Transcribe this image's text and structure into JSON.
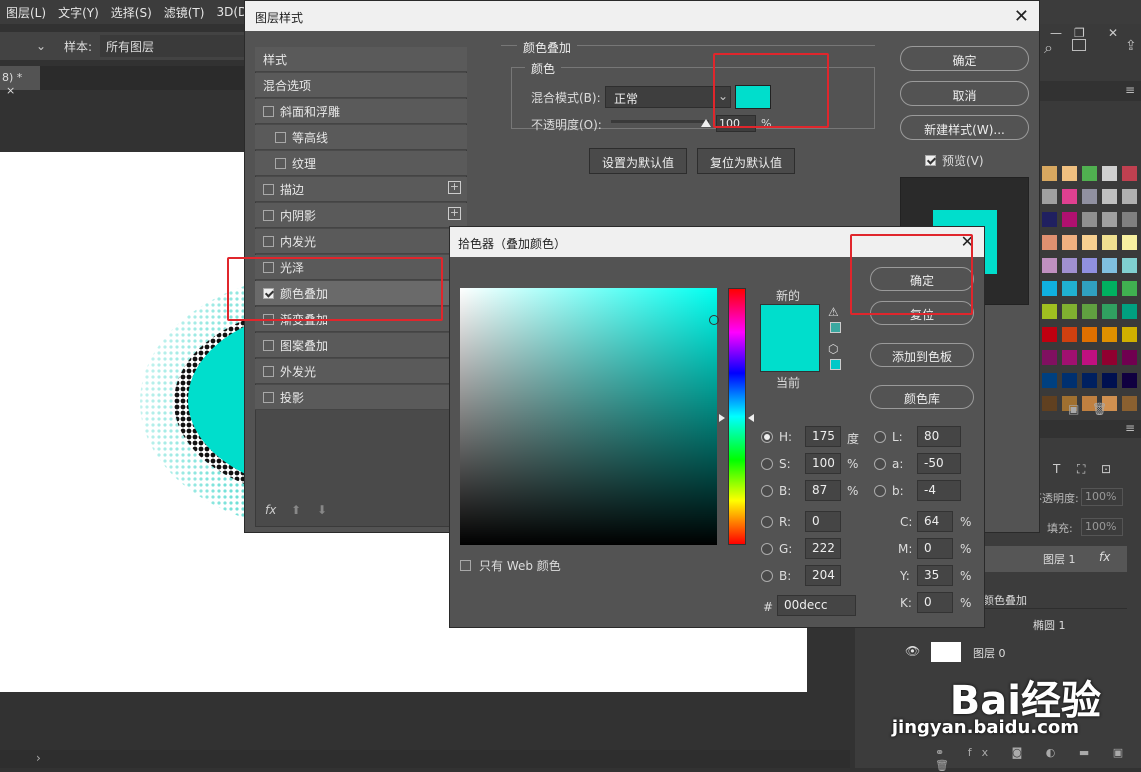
{
  "menubar": {
    "items": [
      "图层(L)",
      "文字(Y)",
      "选择(S)",
      "滤镜(T)",
      "3D(D)"
    ]
  },
  "options_bar": {
    "sample_label": "样本:",
    "sample_value": "所有图层"
  },
  "doc_tab": {
    "label": "8) *",
    "close": "×"
  },
  "layer_style_dialog": {
    "title": "图层样式",
    "close": "✕",
    "left_list": {
      "styles_header": "样式",
      "blend_options": "混合选项",
      "items": [
        {
          "label": "斜面和浮雕",
          "checked": false
        },
        {
          "label": "等高线",
          "checked": false
        },
        {
          "label": "纹理",
          "checked": false
        },
        {
          "label": "描边",
          "checked": false
        },
        {
          "label": "内阴影",
          "checked": false
        },
        {
          "label": "内发光",
          "checked": false
        },
        {
          "label": "光泽",
          "checked": false
        },
        {
          "label": "颜色叠加",
          "checked": true
        },
        {
          "label": "渐变叠加",
          "checked": false
        },
        {
          "label": "图案叠加",
          "checked": false
        },
        {
          "label": "外发光",
          "checked": false
        },
        {
          "label": "投影",
          "checked": false
        }
      ],
      "fx_label": "fx"
    },
    "color_overlay": {
      "section_title": "颜色叠加",
      "group_title": "颜色",
      "blend_mode_label": "混合模式(B):",
      "blend_mode_value": "正常",
      "opacity_label": "不透明度(O):",
      "opacity_value": "100",
      "opacity_unit": "%",
      "overlay_color": "#00decc",
      "make_default": "设置为默认值",
      "reset_default": "复位为默认值"
    },
    "buttons": {
      "ok": "确定",
      "cancel": "取消",
      "new_style": "新建样式(W)...",
      "preview": "预览(V)"
    }
  },
  "color_picker": {
    "title": "拾色器（叠加颜色）",
    "close": "✕",
    "new_label": "新的",
    "current_label": "当前",
    "new_color": "#00decc",
    "current_color": "#00decc",
    "buttons": {
      "ok": "确定",
      "reset": "复位",
      "add_swatch": "添加到色板",
      "libraries": "颜色库"
    },
    "web_only": "只有 Web 颜色",
    "hsb": {
      "h_label": "H:",
      "h": "175",
      "h_unit": "度",
      "s_label": "S:",
      "s": "100",
      "s_unit": "%",
      "b_label": "B:",
      "b": "87",
      "b_unit": "%"
    },
    "rgb": {
      "r_label": "R:",
      "r": "0",
      "g_label": "G:",
      "g": "222",
      "b_label": "B:",
      "b": "204"
    },
    "lab": {
      "l_label": "L:",
      "l": "80",
      "a_label": "a:",
      "a": "-50",
      "b_label": "b:",
      "b": "-4"
    },
    "cmyk": {
      "c_label": "C:",
      "c": "64",
      "m_label": "M:",
      "m": "0",
      "y_label": "Y:",
      "y": "35",
      "k_label": "K:",
      "k": "0",
      "unit": "%"
    },
    "hex_label": "#",
    "hex": "00decc"
  },
  "layers_panel": {
    "opacity_label": "不透明度:",
    "opacity_value": "100%",
    "fill_label": "填充:",
    "fill_value": "100%",
    "layers": [
      {
        "name": "图层 1",
        "fx": "fx"
      },
      {
        "name": "颜色叠加"
      },
      {
        "name": "椭圆 1"
      },
      {
        "name": "图层 0"
      }
    ]
  },
  "watermark": {
    "brand": "Bai经验",
    "url": "jingyan.baidu.com"
  }
}
